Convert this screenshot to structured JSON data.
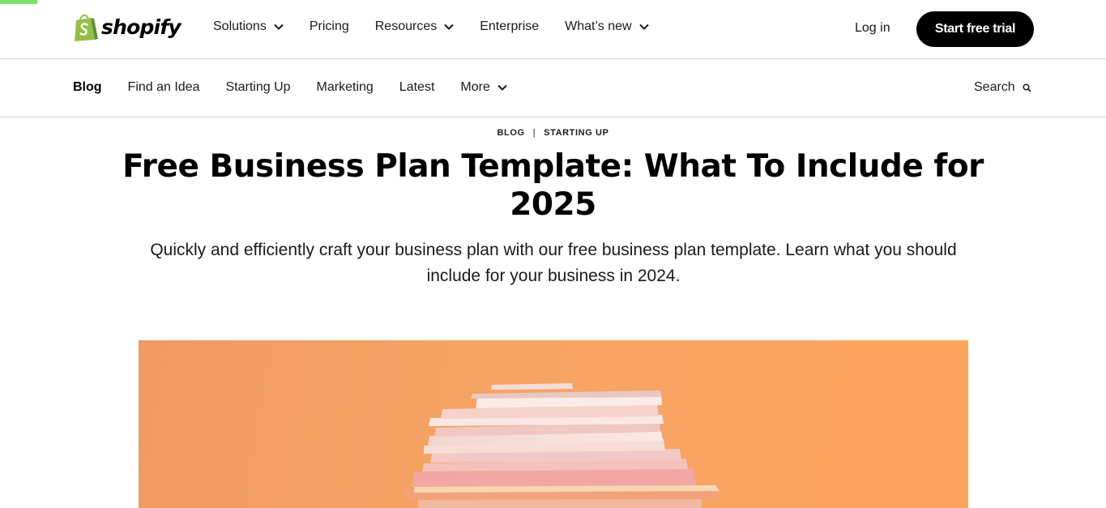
{
  "progress": {
    "fraction": 0.034,
    "color": "#7ae26b"
  },
  "topnav": {
    "logo_text": "shopify",
    "links": [
      {
        "label": "Solutions",
        "has_dropdown": true
      },
      {
        "label": "Pricing",
        "has_dropdown": false
      },
      {
        "label": "Resources",
        "has_dropdown": true
      },
      {
        "label": "Enterprise",
        "has_dropdown": false
      },
      {
        "label": "What’s new",
        "has_dropdown": true
      }
    ],
    "login_label": "Log in",
    "cta_label": "Start free trial"
  },
  "subnav": {
    "links": [
      {
        "label": "Blog",
        "active": true
      },
      {
        "label": "Find an Idea",
        "active": false
      },
      {
        "label": "Starting Up",
        "active": false
      },
      {
        "label": "Marketing",
        "active": false
      },
      {
        "label": "Latest",
        "active": false
      },
      {
        "label": "More",
        "active": false,
        "has_dropdown": true
      }
    ],
    "search_label": "Search"
  },
  "article": {
    "breadcrumb": [
      "BLOG",
      "STARTING UP"
    ],
    "breadcrumb_separator": "|",
    "title": "Free Business Plan Template: What To Include for 2025",
    "subtitle": "Quickly and efficiently craft your business plan with our free business plan template. Learn what you should include for your business in 2024.",
    "hero_image": "stack-of-books-on-orange-background"
  },
  "colors": {
    "brand_green": "#95bf47",
    "cta_bg": "#000000",
    "hero_bg": "#f6a466"
  }
}
